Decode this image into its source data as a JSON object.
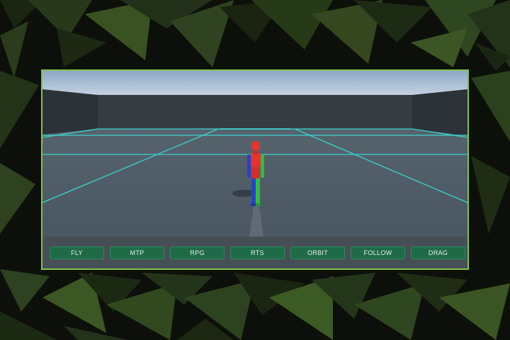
{
  "colors": {
    "frame_border": "#7fc24e",
    "button_bg": "#1f6b48",
    "grid_line": "#38d6cf",
    "sky": "#b6cbe0",
    "floor": "#4b5964",
    "wall": "#31373d",
    "character_head_torso": "#e5342b",
    "character_left_limbs": "#2a3fd1",
    "character_right_limbs": "#2fbf3c"
  },
  "camera_modes": [
    {
      "label": "FLY"
    },
    {
      "label": "MTP"
    },
    {
      "label": "RPG"
    },
    {
      "label": "RTS"
    },
    {
      "label": "ORBIT"
    },
    {
      "label": "FOLLOW"
    },
    {
      "label": "DRAG"
    }
  ]
}
